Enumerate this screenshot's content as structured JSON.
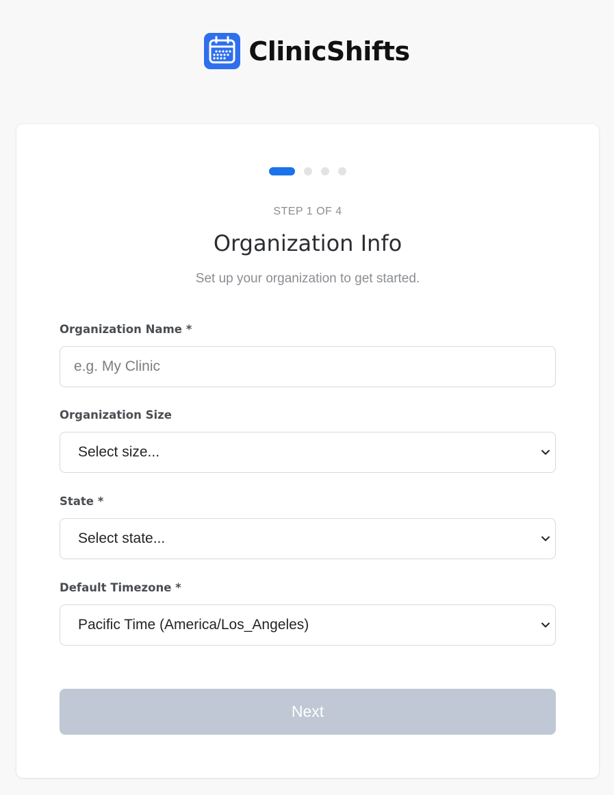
{
  "brand": {
    "name": "ClinicShifts",
    "icon": "calendar-icon",
    "accent": "#2f6fed"
  },
  "stepper": {
    "total": 4,
    "current": 1,
    "label": "STEP 1 OF 4"
  },
  "page": {
    "title": "Organization Info",
    "subtitle": "Set up your organization to get started."
  },
  "form": {
    "org_name": {
      "label": "Organization Name *",
      "placeholder": "e.g. My Clinic",
      "value": ""
    },
    "org_size": {
      "label": "Organization Size",
      "selected": "Select size..."
    },
    "state": {
      "label": "State *",
      "selected": "Select state..."
    },
    "timezone": {
      "label": "Default Timezone *",
      "selected": "Pacific Time (America/Los_Angeles)"
    }
  },
  "actions": {
    "next_label": "Next",
    "next_color": "#bfc8d4"
  }
}
